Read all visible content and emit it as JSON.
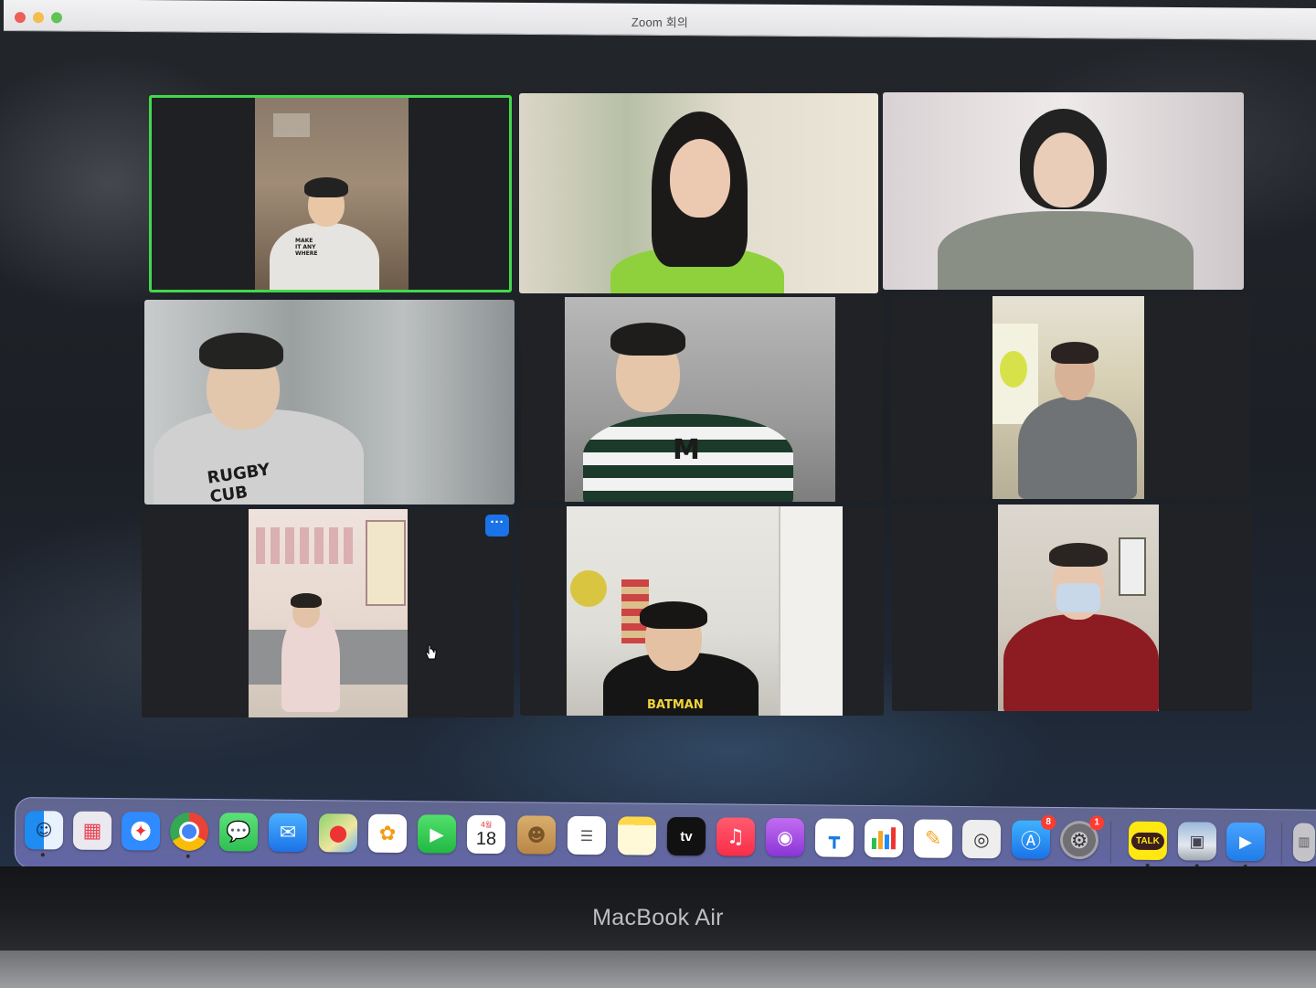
{
  "window": {
    "title": "Zoom 회의"
  },
  "participants": [
    {
      "id": "p1",
      "speaking": true
    },
    {
      "id": "p2"
    },
    {
      "id": "p3"
    },
    {
      "id": "p4"
    },
    {
      "id": "p5"
    },
    {
      "id": "p6"
    },
    {
      "id": "p7"
    },
    {
      "id": "p8"
    },
    {
      "id": "p9"
    }
  ],
  "tile_menu": {
    "label": "···"
  },
  "shirt_prints": {
    "p4": "RUGBY CUB",
    "p5": "M",
    "p8": "BATMAN",
    "p1": "MAKE IT ANY WHERE"
  },
  "dock": {
    "items": [
      {
        "name": "Finder",
        "icon": "finder-icon",
        "color": "#1e8cf0"
      },
      {
        "name": "Launchpad",
        "icon": "launchpad-icon",
        "color": "#e9e9ef"
      },
      {
        "name": "Safari",
        "icon": "safari-icon",
        "color": "#2f8bff"
      },
      {
        "name": "Chrome",
        "icon": "chrome-icon",
        "color": "#ffffff"
      },
      {
        "name": "Messages",
        "icon": "messages-icon",
        "color": "#34c759"
      },
      {
        "name": "Mail",
        "icon": "mail-icon",
        "color": "#1a8cff"
      },
      {
        "name": "Maps",
        "icon": "maps-icon",
        "color": "#8fd16e"
      },
      {
        "name": "Photos",
        "icon": "photos-icon",
        "color": "#ffffff"
      },
      {
        "name": "FaceTime",
        "icon": "facetime-icon",
        "color": "#2bc653"
      },
      {
        "name": "Calendar",
        "icon": "calendar-icon",
        "color": "#ffffff",
        "month": "4월",
        "day": "18"
      },
      {
        "name": "Contacts",
        "icon": "contacts-icon",
        "color": "#c79a5b"
      },
      {
        "name": "Reminders",
        "icon": "reminders-icon",
        "color": "#ffffff"
      },
      {
        "name": "Notes",
        "icon": "notes-icon",
        "color": "#fff3b0"
      },
      {
        "name": "TV",
        "icon": "tv-icon",
        "color": "#111111",
        "label": "tv"
      },
      {
        "name": "Music",
        "icon": "music-icon",
        "color": "#fa2d48"
      },
      {
        "name": "Podcasts",
        "icon": "podcasts-icon",
        "color": "#9a43e0"
      },
      {
        "name": "Keynote",
        "icon": "keynote-icon",
        "color": "#ffffff"
      },
      {
        "name": "Numbers",
        "icon": "numbers-icon",
        "color": "#ffffff"
      },
      {
        "name": "Pages",
        "icon": "pages-icon",
        "color": "#ffffff"
      },
      {
        "name": "Preview",
        "icon": "preview-icon",
        "color": "#eeeeee"
      },
      {
        "name": "App Store",
        "icon": "appstore-icon",
        "color": "#1a8cff",
        "badge": "8"
      },
      {
        "name": "System Preferences",
        "icon": "settings-icon",
        "color": "#8e8e93",
        "badge": "1"
      },
      {
        "name": "KakaoTalk",
        "icon": "kakaotalk-icon",
        "color": "#ffe812",
        "label": "TALK"
      },
      {
        "name": "Image",
        "icon": "image-viewer-icon",
        "color": "#cfd6e2"
      },
      {
        "name": "Zoom",
        "icon": "zoom-icon",
        "color": "#2d8cff"
      },
      {
        "name": "Trash",
        "icon": "trash-icon",
        "color": "#c4c4c8"
      }
    ]
  },
  "device": {
    "label": "MacBook Air"
  }
}
